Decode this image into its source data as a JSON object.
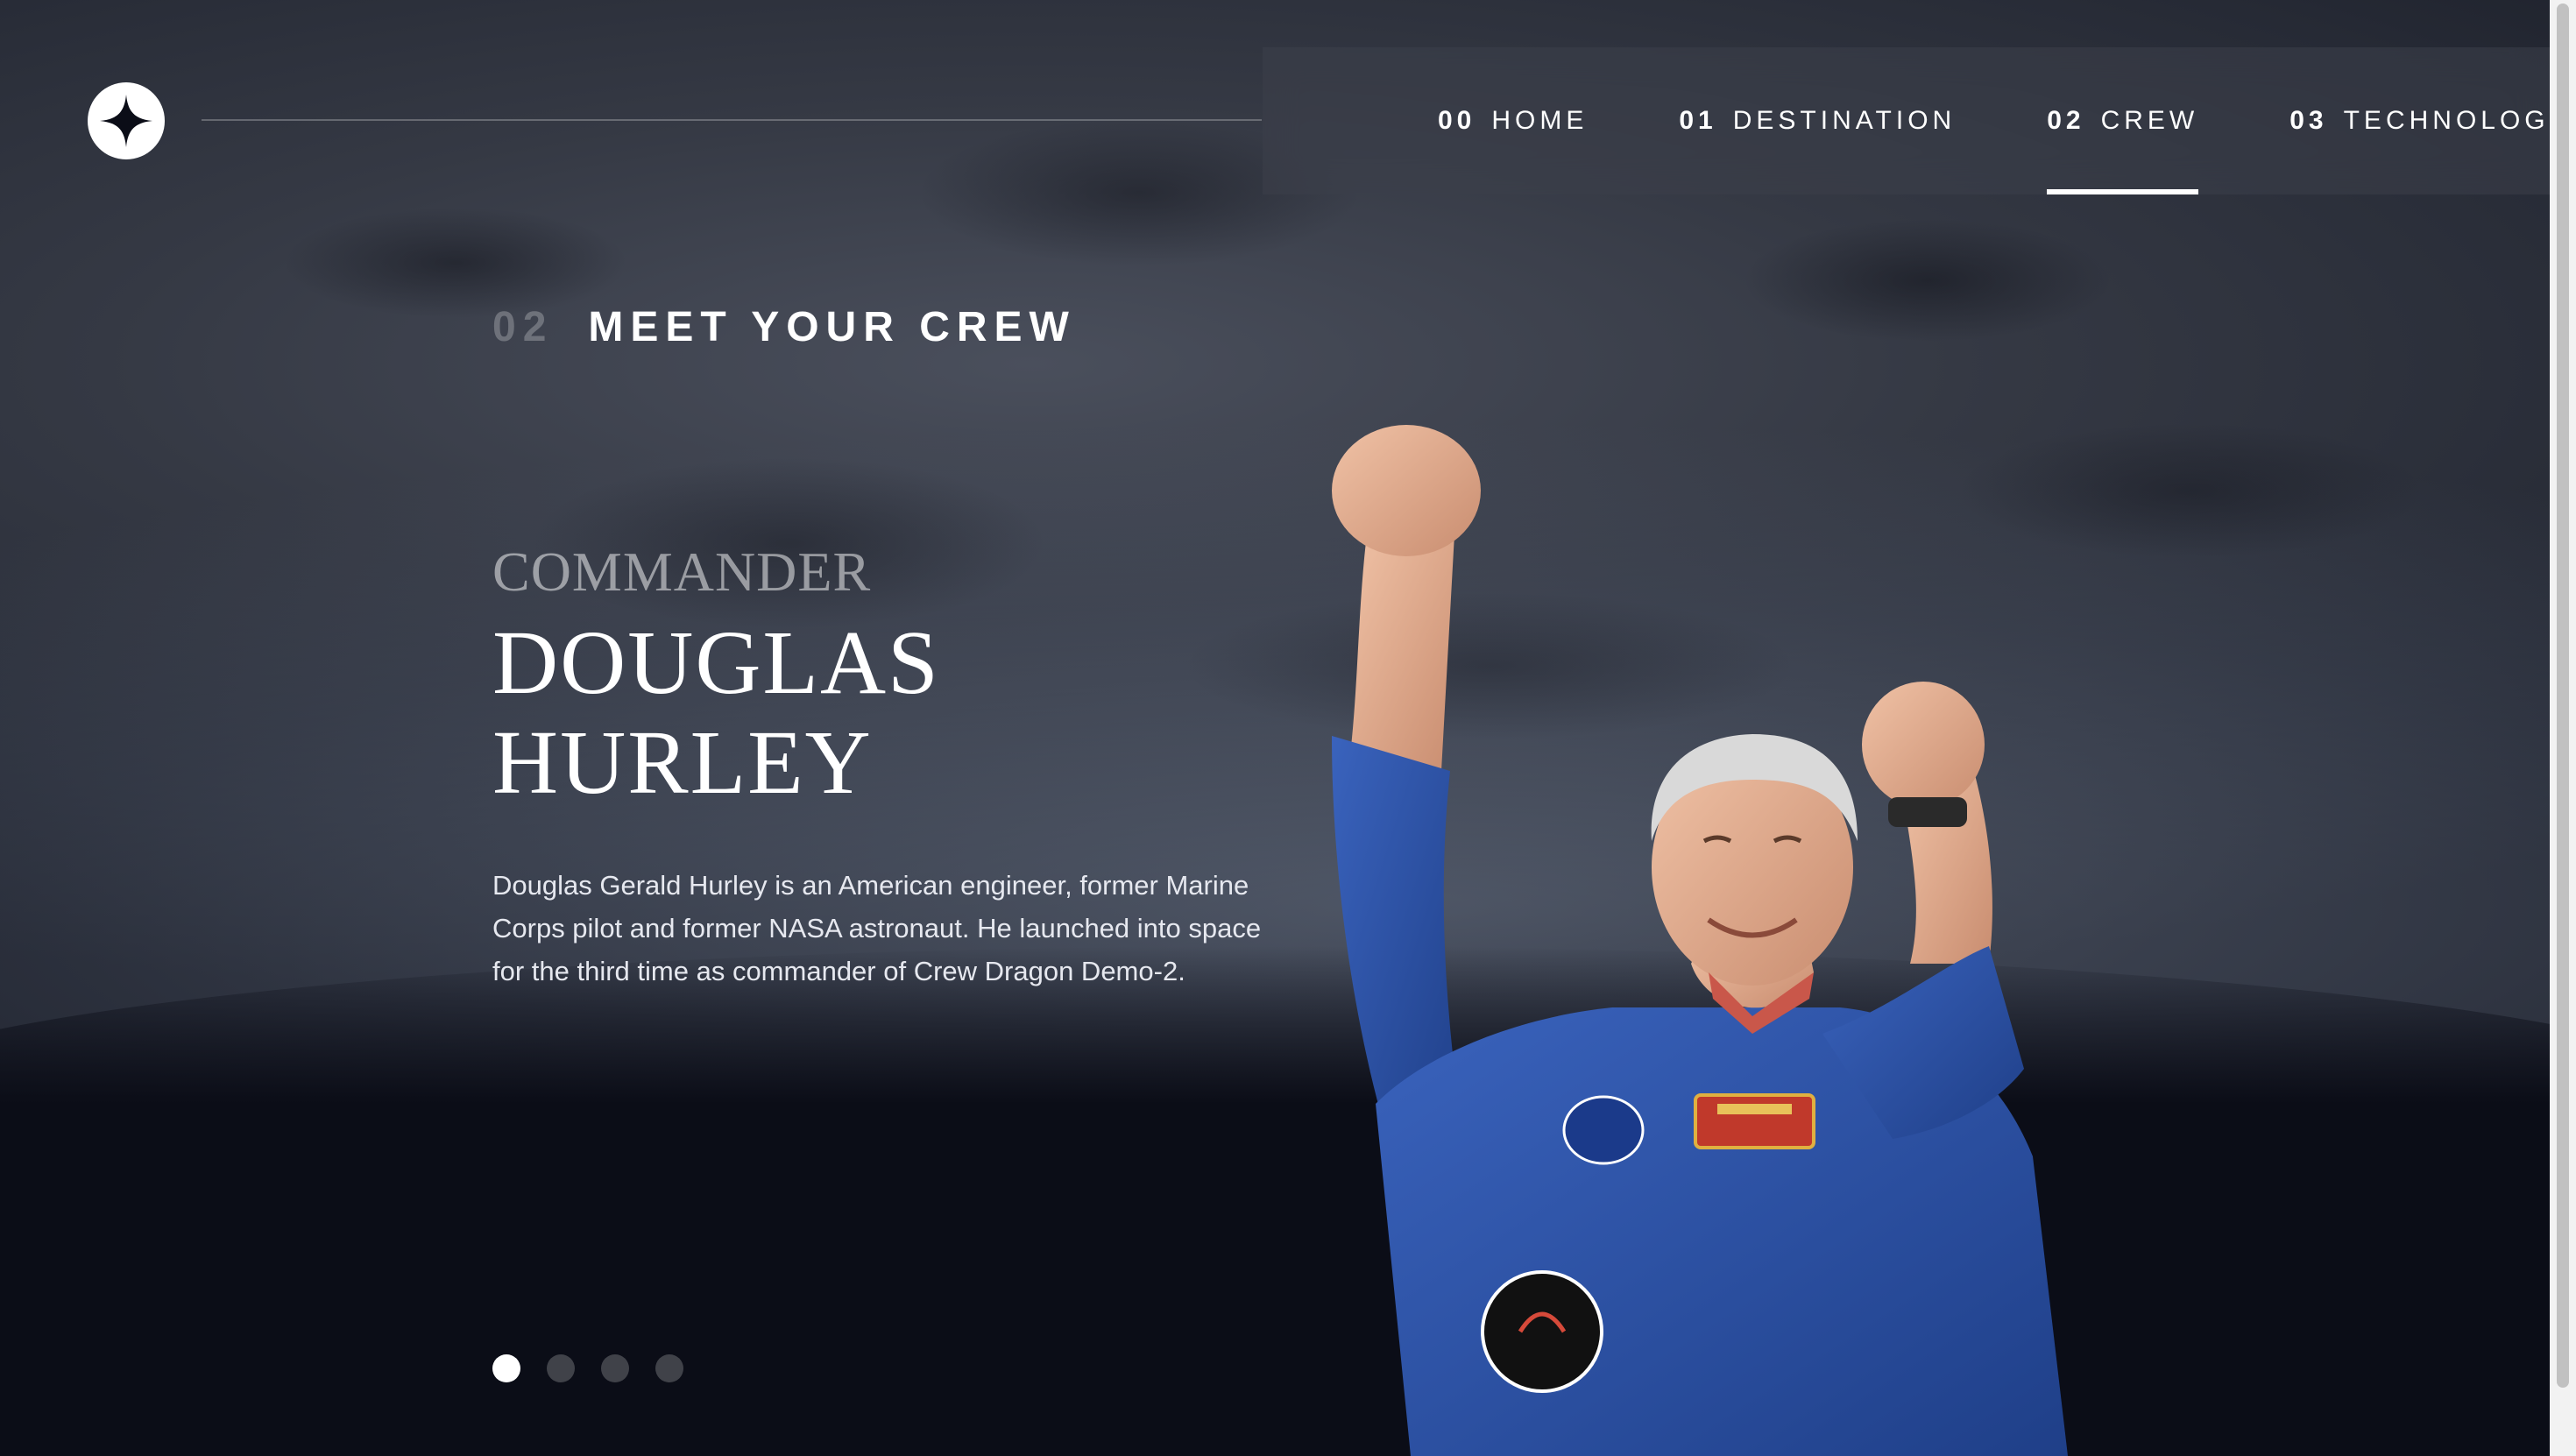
{
  "brand": {
    "logo_icon": "star-icon"
  },
  "nav": {
    "items": [
      {
        "num": "00",
        "label": "HOME"
      },
      {
        "num": "01",
        "label": "DESTINATION"
      },
      {
        "num": "02",
        "label": "CREW",
        "active": true
      },
      {
        "num": "03",
        "label": "TECHNOLOGY"
      }
    ]
  },
  "section": {
    "num": "02",
    "title": "MEET YOUR CREW"
  },
  "crew": {
    "role": "COMMANDER",
    "name_line1": "DOUGLAS",
    "name_line2": "HURLEY",
    "bio": "Douglas Gerald Hurley is an American engineer, former Marine Corps pilot and former NASA astronaut. He launched into space for the third time as commander of Crew Dragon Demo-2."
  },
  "carousel": {
    "count": 4,
    "active_index": 0
  },
  "colors": {
    "background": "#0b0d17",
    "accent": "#ffffff",
    "suit": "#2b4fa0"
  }
}
